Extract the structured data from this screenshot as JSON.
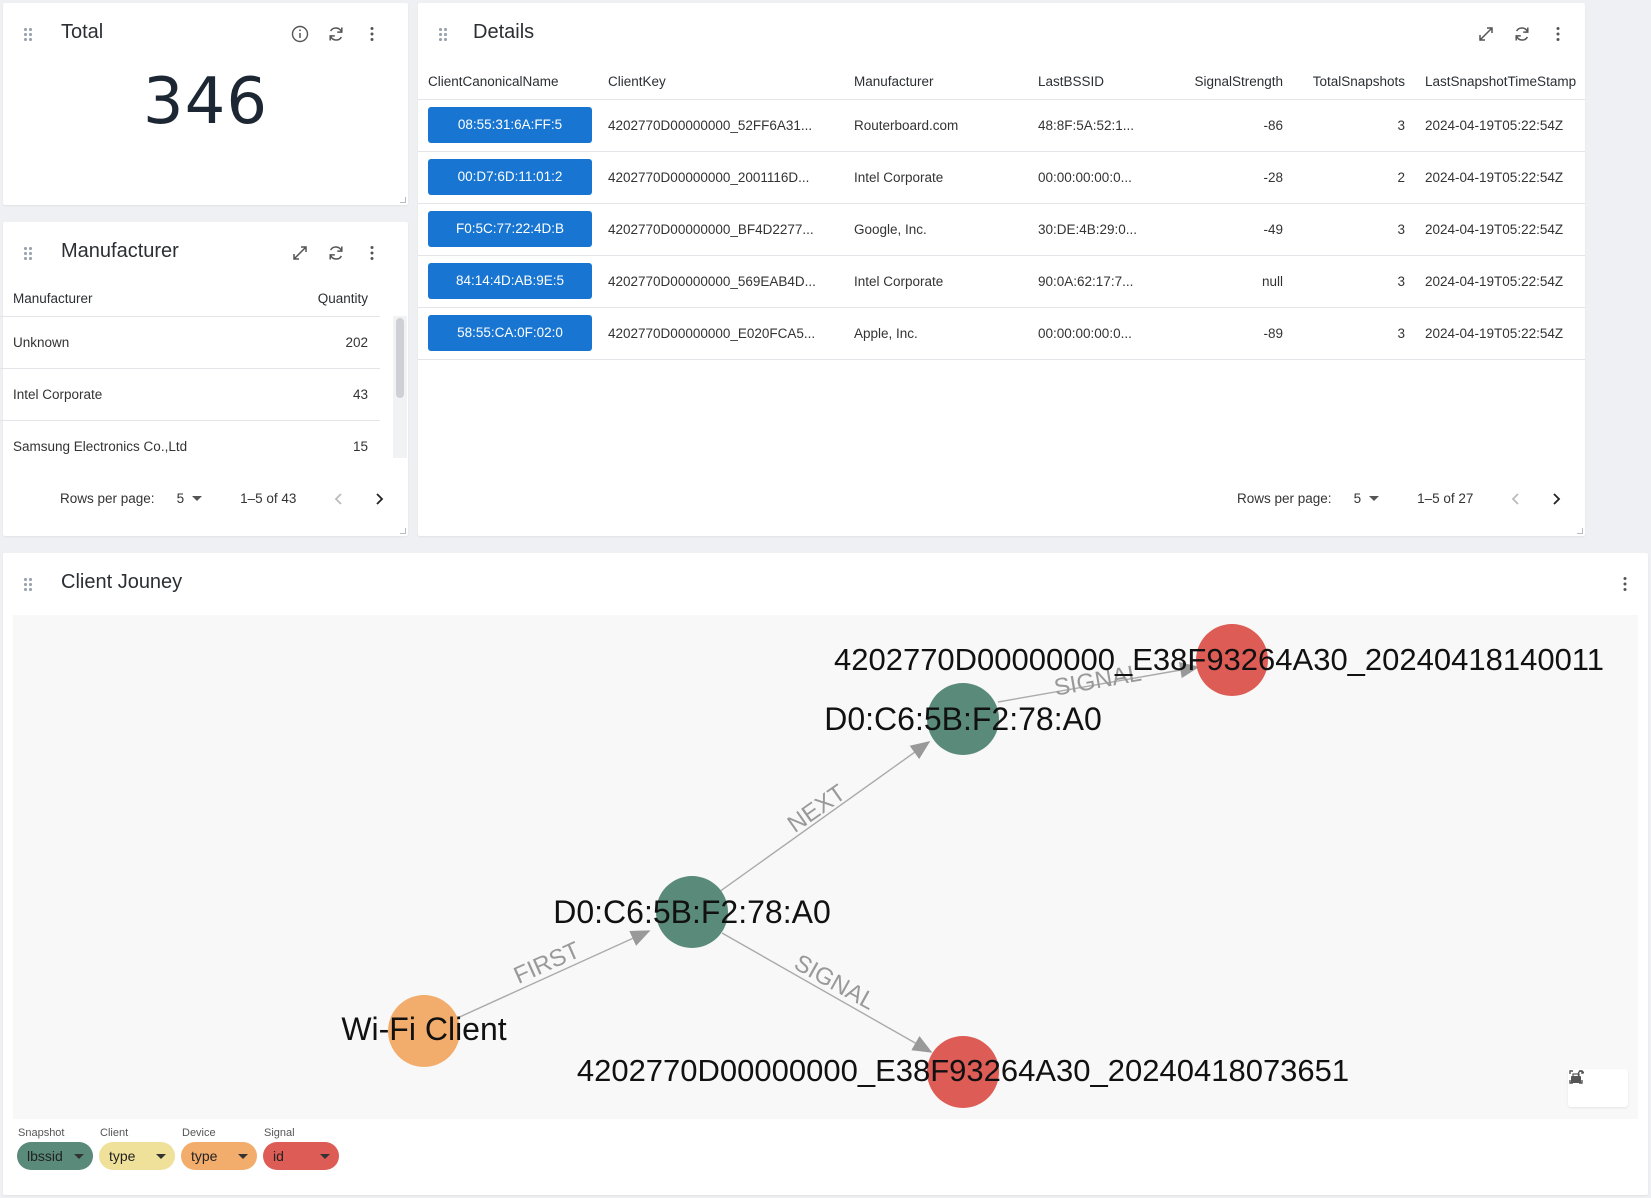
{
  "total": {
    "title": "Total",
    "value": "346"
  },
  "manufacturer": {
    "title": "Manufacturer",
    "columns": [
      "Manufacturer",
      "Quantity"
    ],
    "rows": [
      {
        "name": "Unknown",
        "qty": "202"
      },
      {
        "name": "Intel Corporate",
        "qty": "43"
      },
      {
        "name": "Samsung Electronics Co.,Ltd",
        "qty": "15"
      }
    ],
    "pager": {
      "label": "Rows per page:",
      "per_page": "5",
      "range": "1–5 of 43"
    }
  },
  "details": {
    "title": "Details",
    "columns": [
      "ClientCanonicalName",
      "ClientKey",
      "Manufacturer",
      "LastBSSID",
      "SignalStrength",
      "TotalSnapshots",
      "LastSnapshotTimeStamp"
    ],
    "rows": [
      {
        "name": "08:55:31:6A:FF:5",
        "key": "4202770D00000000_52FF6A31...",
        "mfr": "Routerboard.com",
        "bssid": "48:8F:5A:52:1...",
        "signal": "-86",
        "snaps": "3",
        "ts": "2024-04-19T05:22:54Z"
      },
      {
        "name": "00:D7:6D:11:01:2",
        "key": "4202770D00000000_2001116D...",
        "mfr": "Intel Corporate",
        "bssid": "00:00:00:00:0...",
        "signal": "-28",
        "snaps": "2",
        "ts": "2024-04-19T05:22:54Z"
      },
      {
        "name": "F0:5C:77:22:4D:B",
        "key": "4202770D00000000_BF4D2277...",
        "mfr": "Google, Inc.",
        "bssid": "30:DE:4B:29:0...",
        "signal": "-49",
        "snaps": "3",
        "ts": "2024-04-19T05:22:54Z"
      },
      {
        "name": "84:14:4D:AB:9E:5",
        "key": "4202770D00000000_569EAB4D...",
        "mfr": "Intel Corporate",
        "bssid": "90:0A:62:17:7...",
        "signal": "null",
        "snaps": "3",
        "ts": "2024-04-19T05:22:54Z"
      },
      {
        "name": "58:55:CA:0F:02:0",
        "key": "4202770D00000000_E020FCA5...",
        "mfr": "Apple, Inc.",
        "bssid": "00:00:00:00:0...",
        "signal": "-89",
        "snaps": "3",
        "ts": "2024-04-19T05:22:54Z"
      }
    ],
    "pager": {
      "label": "Rows per page:",
      "per_page": "5",
      "range": "1–5 of 27"
    }
  },
  "journey": {
    "title": "Client Jouney",
    "nodes": {
      "client": "Wi-Fi Client",
      "device1": "D0:C6:5B:F2:78:A0",
      "device2": "D0:C6:5B:F2:78:A0",
      "signal_top": "4202770D00000000_E38F93264A30_20240418140011",
      "signal_bottom": "4202770D00000000_E38F93264A30_20240418073651"
    },
    "edges": {
      "first": "FIRST",
      "next": "NEXT",
      "signal_top": "SIGNAL",
      "signal_bottom": "SIGNAL"
    },
    "legend": [
      {
        "title": "Snapshot",
        "value": "lbssid",
        "color": "#5a8a79"
      },
      {
        "title": "Client",
        "value": "type",
        "color": "#f0e19a"
      },
      {
        "title": "Device",
        "value": "type",
        "color": "#f2ad6c"
      },
      {
        "title": "Signal",
        "value": "id",
        "color": "#dd5c55"
      }
    ],
    "colors": {
      "snapshot": "#5a8a79",
      "client": "#f2ad6c",
      "signal": "#dd5c55"
    }
  }
}
